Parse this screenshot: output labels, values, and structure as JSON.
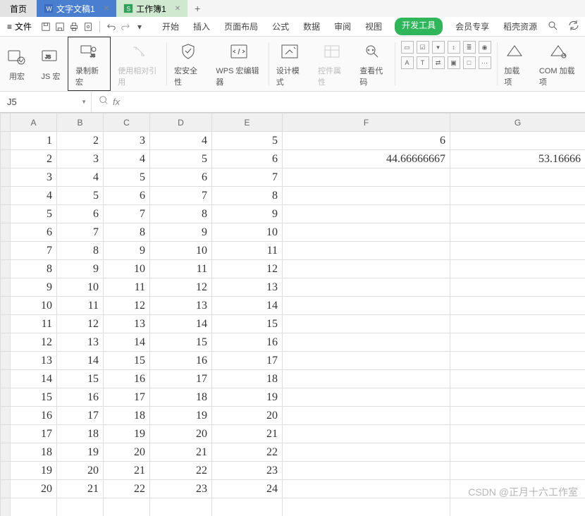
{
  "tabs": {
    "home": "首页",
    "doc": "文字文稿1",
    "sheet": "工作簿1"
  },
  "menu": {
    "file": "文件"
  },
  "ribbon_tabs": [
    "开始",
    "插入",
    "页面布局",
    "公式",
    "数据",
    "审阅",
    "视图",
    "开发工具",
    "会员专享",
    "稻壳资源"
  ],
  "ribbon_active_index": 7,
  "ribbon_groups": {
    "use_macro": "用宏",
    "js_macro": "JS 宏",
    "record_macro": "录制新宏",
    "relative_ref": "使用相对引用",
    "macro_security": "宏安全性",
    "wps_editor": "WPS 宏编辑器",
    "design_mode": "设计模式",
    "control_props": "控件属性",
    "view_code": "查看代码",
    "addins": "加载项",
    "com_addins": "COM 加载项"
  },
  "namebox": {
    "value": "J5"
  },
  "fx": {
    "label": "fx",
    "value": ""
  },
  "columns": [
    "A",
    "B",
    "C",
    "D",
    "E",
    "F",
    "G"
  ],
  "cells": {
    "rows": [
      {
        "a": "1",
        "b": "2",
        "c": "3",
        "d": "4",
        "e": "5",
        "f": "6",
        "g": ""
      },
      {
        "a": "2",
        "b": "3",
        "c": "4",
        "d": "5",
        "e": "6",
        "f": "44.66666667",
        "g": "53.16666"
      },
      {
        "a": "3",
        "b": "4",
        "c": "5",
        "d": "6",
        "e": "7",
        "f": "",
        "g": ""
      },
      {
        "a": "4",
        "b": "5",
        "c": "6",
        "d": "7",
        "e": "8",
        "f": "",
        "g": ""
      },
      {
        "a": "5",
        "b": "6",
        "c": "7",
        "d": "8",
        "e": "9",
        "f": "",
        "g": ""
      },
      {
        "a": "6",
        "b": "7",
        "c": "8",
        "d": "9",
        "e": "10",
        "f": "",
        "g": ""
      },
      {
        "a": "7",
        "b": "8",
        "c": "9",
        "d": "10",
        "e": "11",
        "f": "",
        "g": ""
      },
      {
        "a": "8",
        "b": "9",
        "c": "10",
        "d": "11",
        "e": "12",
        "f": "",
        "g": ""
      },
      {
        "a": "9",
        "b": "10",
        "c": "11",
        "d": "12",
        "e": "13",
        "f": "",
        "g": ""
      },
      {
        "a": "10",
        "b": "11",
        "c": "12",
        "d": "13",
        "e": "14",
        "f": "",
        "g": ""
      },
      {
        "a": "11",
        "b": "12",
        "c": "13",
        "d": "14",
        "e": "15",
        "f": "",
        "g": ""
      },
      {
        "a": "12",
        "b": "13",
        "c": "14",
        "d": "15",
        "e": "16",
        "f": "",
        "g": ""
      },
      {
        "a": "13",
        "b": "14",
        "c": "15",
        "d": "16",
        "e": "17",
        "f": "",
        "g": ""
      },
      {
        "a": "14",
        "b": "15",
        "c": "16",
        "d": "17",
        "e": "18",
        "f": "",
        "g": ""
      },
      {
        "a": "15",
        "b": "16",
        "c": "17",
        "d": "18",
        "e": "19",
        "f": "",
        "g": ""
      },
      {
        "a": "16",
        "b": "17",
        "c": "18",
        "d": "19",
        "e": "20",
        "f": "",
        "g": ""
      },
      {
        "a": "17",
        "b": "18",
        "c": "19",
        "d": "20",
        "e": "21",
        "f": "",
        "g": ""
      },
      {
        "a": "18",
        "b": "19",
        "c": "20",
        "d": "21",
        "e": "22",
        "f": "",
        "g": ""
      },
      {
        "a": "19",
        "b": "20",
        "c": "21",
        "d": "22",
        "e": "23",
        "f": "",
        "g": ""
      },
      {
        "a": "20",
        "b": "21",
        "c": "22",
        "d": "23",
        "e": "24",
        "f": "",
        "g": ""
      },
      {
        "a": "",
        "b": "",
        "c": "",
        "d": "",
        "e": "",
        "f": "",
        "g": ""
      }
    ]
  },
  "watermark": "CSDN @正月十六工作室"
}
